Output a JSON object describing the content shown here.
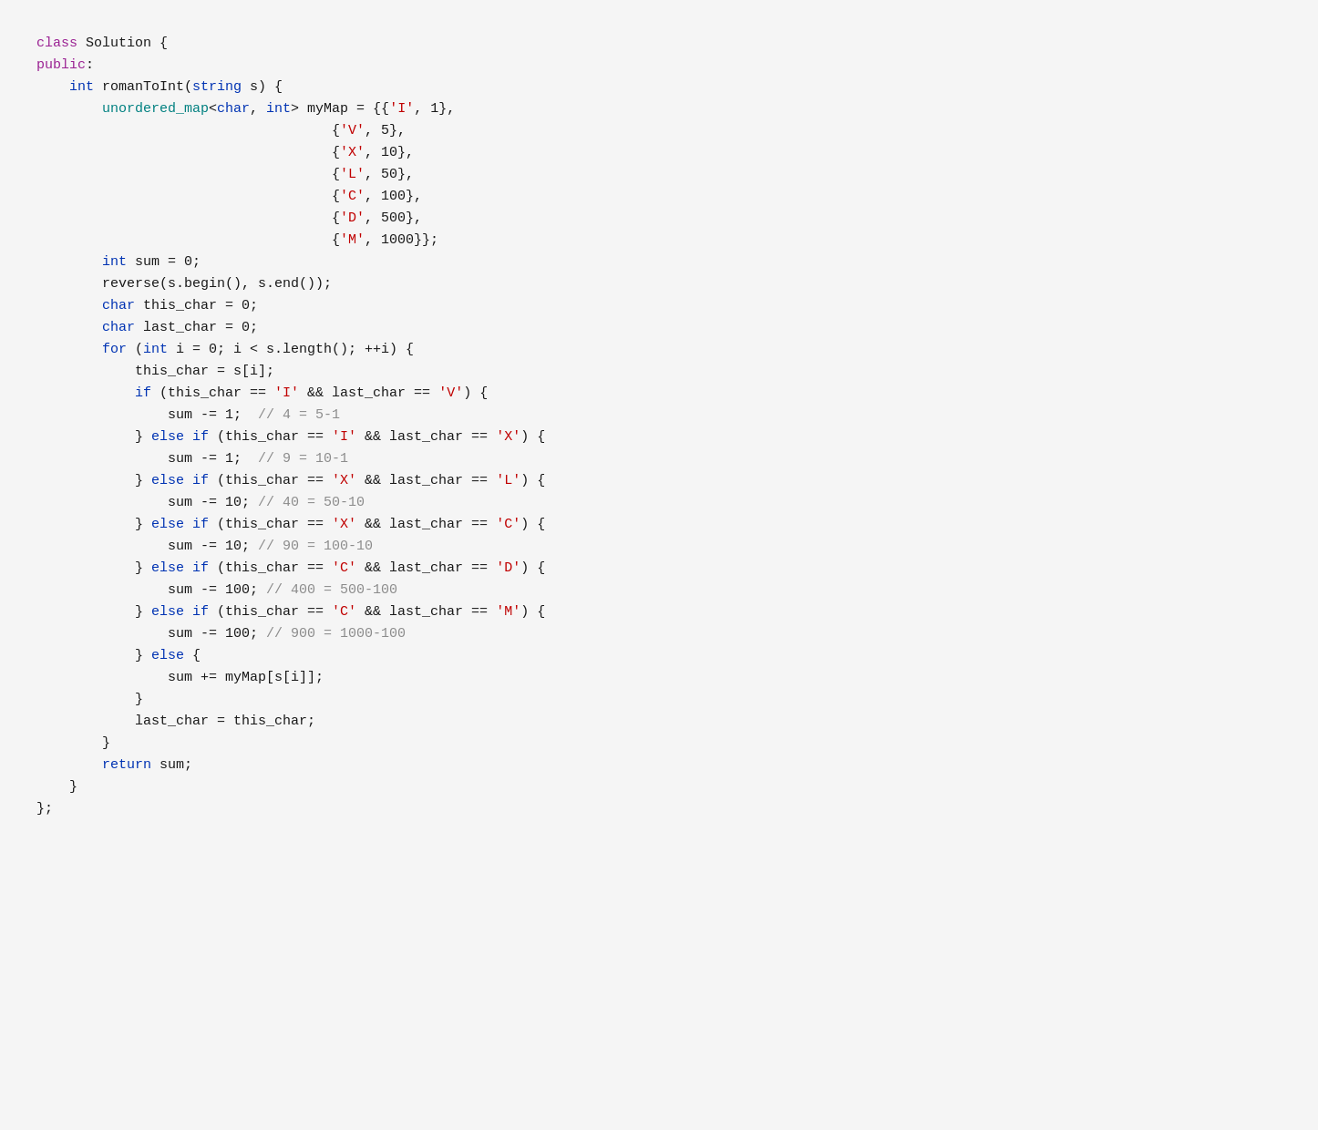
{
  "code": {
    "lines": [
      {
        "tokens": [
          {
            "t": "class ",
            "c": "c-purple"
          },
          {
            "t": "Solution {",
            "c": "c-black"
          }
        ]
      },
      {
        "tokens": [
          {
            "t": "public",
            "c": "c-purple"
          },
          {
            "t": ":",
            "c": "c-black"
          }
        ]
      },
      {
        "tokens": [
          {
            "t": "    ",
            "c": "c-black"
          },
          {
            "t": "int",
            "c": "c-blue"
          },
          {
            "t": " romanToInt(",
            "c": "c-black"
          },
          {
            "t": "string",
            "c": "c-blue"
          },
          {
            "t": " s) {",
            "c": "c-black"
          }
        ]
      },
      {
        "tokens": [
          {
            "t": "        unordered_map",
            "c": "c-teal"
          },
          {
            "t": "<",
            "c": "c-black"
          },
          {
            "t": "char",
            "c": "c-blue"
          },
          {
            "t": ", ",
            "c": "c-black"
          },
          {
            "t": "int",
            "c": "c-blue"
          },
          {
            "t": "> myMap = {{",
            "c": "c-black"
          },
          {
            "t": "'I'",
            "c": "c-red"
          },
          {
            "t": ", 1},",
            "c": "c-black"
          }
        ]
      },
      {
        "tokens": [
          {
            "t": "                                    {",
            "c": "c-black"
          },
          {
            "t": "'V'",
            "c": "c-red"
          },
          {
            "t": ", 5},",
            "c": "c-black"
          }
        ]
      },
      {
        "tokens": [
          {
            "t": "                                    {",
            "c": "c-black"
          },
          {
            "t": "'X'",
            "c": "c-red"
          },
          {
            "t": ", 10},",
            "c": "c-black"
          }
        ]
      },
      {
        "tokens": [
          {
            "t": "                                    {",
            "c": "c-black"
          },
          {
            "t": "'L'",
            "c": "c-red"
          },
          {
            "t": ", 50},",
            "c": "c-black"
          }
        ]
      },
      {
        "tokens": [
          {
            "t": "                                    {",
            "c": "c-black"
          },
          {
            "t": "'C'",
            "c": "c-red"
          },
          {
            "t": ", 100},",
            "c": "c-black"
          }
        ]
      },
      {
        "tokens": [
          {
            "t": "                                    {",
            "c": "c-black"
          },
          {
            "t": "'D'",
            "c": "c-red"
          },
          {
            "t": ", 500},",
            "c": "c-black"
          }
        ]
      },
      {
        "tokens": [
          {
            "t": "                                    {",
            "c": "c-black"
          },
          {
            "t": "'M'",
            "c": "c-red"
          },
          {
            "t": ", 1000}};",
            "c": "c-black"
          }
        ]
      },
      {
        "tokens": [
          {
            "t": "",
            "c": "c-black"
          }
        ]
      },
      {
        "tokens": [
          {
            "t": "        ",
            "c": "c-black"
          },
          {
            "t": "int",
            "c": "c-blue"
          },
          {
            "t": " sum = 0;",
            "c": "c-black"
          }
        ]
      },
      {
        "tokens": [
          {
            "t": "        reverse(s.begin(), s.end());",
            "c": "c-black"
          }
        ]
      },
      {
        "tokens": [
          {
            "t": "        ",
            "c": "c-black"
          },
          {
            "t": "char",
            "c": "c-blue"
          },
          {
            "t": " this_char = 0;",
            "c": "c-black"
          }
        ]
      },
      {
        "tokens": [
          {
            "t": "        ",
            "c": "c-black"
          },
          {
            "t": "char",
            "c": "c-blue"
          },
          {
            "t": " last_char = 0;",
            "c": "c-black"
          }
        ]
      },
      {
        "tokens": [
          {
            "t": "        ",
            "c": "c-black"
          },
          {
            "t": "for",
            "c": "c-blue"
          },
          {
            "t": " (",
            "c": "c-black"
          },
          {
            "t": "int",
            "c": "c-blue"
          },
          {
            "t": " i = 0; i < s.length(); ++i) {",
            "c": "c-black"
          }
        ]
      },
      {
        "tokens": [
          {
            "t": "            this_char = s[i];",
            "c": "c-black"
          }
        ]
      },
      {
        "tokens": [
          {
            "t": "            ",
            "c": "c-black"
          },
          {
            "t": "if",
            "c": "c-blue"
          },
          {
            "t": " (this_char == ",
            "c": "c-black"
          },
          {
            "t": "'I'",
            "c": "c-red"
          },
          {
            "t": " && last_char == ",
            "c": "c-black"
          },
          {
            "t": "'V'",
            "c": "c-red"
          },
          {
            "t": ") {",
            "c": "c-black"
          }
        ]
      },
      {
        "tokens": [
          {
            "t": "                sum -= 1;  ",
            "c": "c-black"
          },
          {
            "t": "// 4 = 5-1",
            "c": "c-gray"
          }
        ]
      },
      {
        "tokens": [
          {
            "t": "            } ",
            "c": "c-black"
          },
          {
            "t": "else if",
            "c": "c-blue"
          },
          {
            "t": " (this_char == ",
            "c": "c-black"
          },
          {
            "t": "'I'",
            "c": "c-red"
          },
          {
            "t": " && last_char == ",
            "c": "c-black"
          },
          {
            "t": "'X'",
            "c": "c-red"
          },
          {
            "t": ") {",
            "c": "c-black"
          }
        ]
      },
      {
        "tokens": [
          {
            "t": "                sum -= 1;  ",
            "c": "c-black"
          },
          {
            "t": "// 9 = 10-1",
            "c": "c-gray"
          }
        ]
      },
      {
        "tokens": [
          {
            "t": "            } ",
            "c": "c-black"
          },
          {
            "t": "else if",
            "c": "c-blue"
          },
          {
            "t": " (this_char == ",
            "c": "c-black"
          },
          {
            "t": "'X'",
            "c": "c-red"
          },
          {
            "t": " && last_char == ",
            "c": "c-black"
          },
          {
            "t": "'L'",
            "c": "c-red"
          },
          {
            "t": ") {",
            "c": "c-black"
          }
        ]
      },
      {
        "tokens": [
          {
            "t": "                sum -= 10; ",
            "c": "c-black"
          },
          {
            "t": "// 40 = 50-10",
            "c": "c-gray"
          }
        ]
      },
      {
        "tokens": [
          {
            "t": "            } ",
            "c": "c-black"
          },
          {
            "t": "else if",
            "c": "c-blue"
          },
          {
            "t": " (this_char == ",
            "c": "c-black"
          },
          {
            "t": "'X'",
            "c": "c-red"
          },
          {
            "t": " && last_char == ",
            "c": "c-black"
          },
          {
            "t": "'C'",
            "c": "c-red"
          },
          {
            "t": ") {",
            "c": "c-black"
          }
        ]
      },
      {
        "tokens": [
          {
            "t": "                sum -= 10; ",
            "c": "c-black"
          },
          {
            "t": "// 90 = 100-10",
            "c": "c-gray"
          }
        ]
      },
      {
        "tokens": [
          {
            "t": "            } ",
            "c": "c-black"
          },
          {
            "t": "else if",
            "c": "c-blue"
          },
          {
            "t": " (this_char == ",
            "c": "c-black"
          },
          {
            "t": "'C'",
            "c": "c-red"
          },
          {
            "t": " && last_char == ",
            "c": "c-black"
          },
          {
            "t": "'D'",
            "c": "c-red"
          },
          {
            "t": ") {",
            "c": "c-black"
          }
        ]
      },
      {
        "tokens": [
          {
            "t": "                sum -= 100; ",
            "c": "c-black"
          },
          {
            "t": "// 400 = 500-100",
            "c": "c-gray"
          }
        ]
      },
      {
        "tokens": [
          {
            "t": "            } ",
            "c": "c-black"
          },
          {
            "t": "else if",
            "c": "c-blue"
          },
          {
            "t": " (this_char == ",
            "c": "c-black"
          },
          {
            "t": "'C'",
            "c": "c-red"
          },
          {
            "t": " && last_char == ",
            "c": "c-black"
          },
          {
            "t": "'M'",
            "c": "c-red"
          },
          {
            "t": ") {",
            "c": "c-black"
          }
        ]
      },
      {
        "tokens": [
          {
            "t": "                sum -= 100; ",
            "c": "c-black"
          },
          {
            "t": "// 900 = 1000-100",
            "c": "c-gray"
          }
        ]
      },
      {
        "tokens": [
          {
            "t": "            } ",
            "c": "c-black"
          },
          {
            "t": "else",
            "c": "c-blue"
          },
          {
            "t": " {",
            "c": "c-black"
          }
        ]
      },
      {
        "tokens": [
          {
            "t": "                sum += myMap[s[i]];",
            "c": "c-black"
          }
        ]
      },
      {
        "tokens": [
          {
            "t": "            }",
            "c": "c-black"
          }
        ]
      },
      {
        "tokens": [
          {
            "t": "            last_char = this_char;",
            "c": "c-black"
          }
        ]
      },
      {
        "tokens": [
          {
            "t": "        }",
            "c": "c-black"
          }
        ]
      },
      {
        "tokens": [
          {
            "t": "        ",
            "c": "c-black"
          },
          {
            "t": "return",
            "c": "c-blue"
          },
          {
            "t": " sum;",
            "c": "c-black"
          }
        ]
      },
      {
        "tokens": [
          {
            "t": "    }",
            "c": "c-black"
          }
        ]
      },
      {
        "tokens": [
          {
            "t": "};",
            "c": "c-black"
          }
        ]
      }
    ]
  }
}
